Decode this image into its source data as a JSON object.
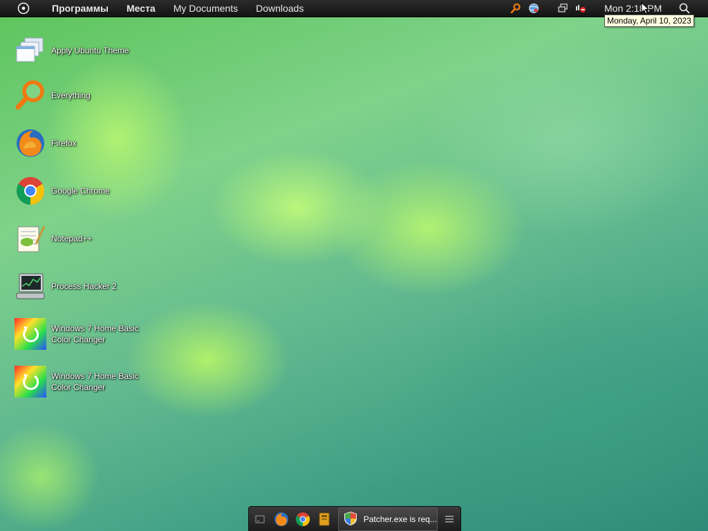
{
  "top_panel": {
    "menu": [
      {
        "label": "Программы"
      },
      {
        "label": "Места"
      },
      {
        "label": "My Documents"
      },
      {
        "label": "Downloads"
      }
    ],
    "clock": "Mon 2:18 PM",
    "clock_tooltip": "Monday, April 10, 2023"
  },
  "desktop_icons": [
    {
      "label": "Apply Ubuntu Theme",
      "icon": "theme-windows-icon"
    },
    {
      "label": "Everything",
      "icon": "magnifier-icon"
    },
    {
      "label": "Firefox",
      "icon": "firefox-icon"
    },
    {
      "label": "Google Chrome",
      "icon": "chrome-icon"
    },
    {
      "label": "Notepad++",
      "icon": "notepad-plus-plus-icon"
    },
    {
      "label": "Process Hacker 2",
      "icon": "process-hacker-icon"
    },
    {
      "label": "Windows 7 Home Basic Color Changer",
      "icon": "color-changer-icon"
    },
    {
      "label": "Windows 7 Home Basic Color Changer",
      "icon": "color-changer-icon"
    }
  ],
  "dock": {
    "task_label": "Patcher.exe is req..."
  },
  "colors": {
    "accent_orange": "#f07a10",
    "panel_bg": "#1c1c1c",
    "tooltip_bg": "#ffffe1"
  }
}
